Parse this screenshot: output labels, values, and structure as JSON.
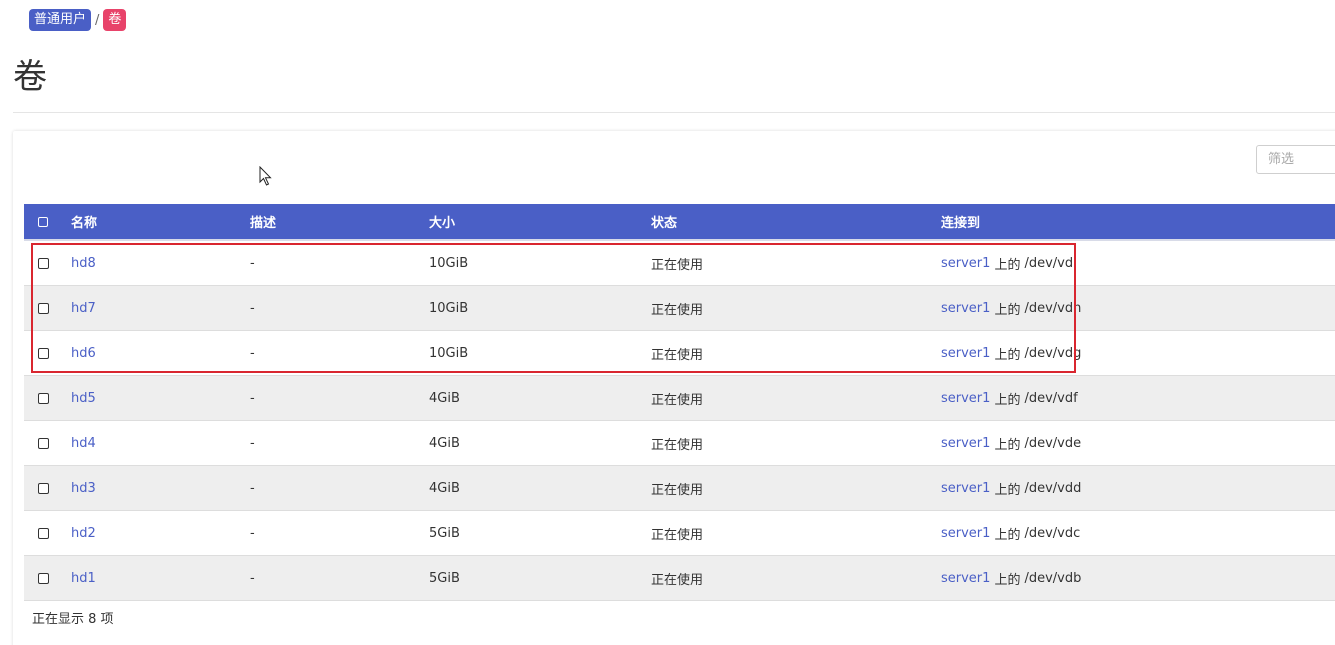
{
  "breadcrumb": {
    "user": "普通用户",
    "separator": "/",
    "current": "卷"
  },
  "page_title": "卷",
  "filter": {
    "placeholder": "筛选",
    "value": ""
  },
  "table": {
    "headers": {
      "name": "名称",
      "description": "描述",
      "size": "大小",
      "status": "状态",
      "attached_to": "连接到"
    },
    "rows": [
      {
        "name": "hd8",
        "description": "-",
        "size": "10GiB",
        "status": "正在使用",
        "server": "server1",
        "on": "上的",
        "device": "/dev/vdi"
      },
      {
        "name": "hd7",
        "description": "-",
        "size": "10GiB",
        "status": "正在使用",
        "server": "server1",
        "on": "上的",
        "device": "/dev/vdh"
      },
      {
        "name": "hd6",
        "description": "-",
        "size": "10GiB",
        "status": "正在使用",
        "server": "server1",
        "on": "上的",
        "device": "/dev/vdg"
      },
      {
        "name": "hd5",
        "description": "-",
        "size": "4GiB",
        "status": "正在使用",
        "server": "server1",
        "on": "上的",
        "device": "/dev/vdf"
      },
      {
        "name": "hd4",
        "description": "-",
        "size": "4GiB",
        "status": "正在使用",
        "server": "server1",
        "on": "上的",
        "device": "/dev/vde"
      },
      {
        "name": "hd3",
        "description": "-",
        "size": "4GiB",
        "status": "正在使用",
        "server": "server1",
        "on": "上的",
        "device": "/dev/vdd"
      },
      {
        "name": "hd2",
        "description": "-",
        "size": "5GiB",
        "status": "正在使用",
        "server": "server1",
        "on": "上的",
        "device": "/dev/vdc"
      },
      {
        "name": "hd1",
        "description": "-",
        "size": "5GiB",
        "status": "正在使用",
        "server": "server1",
        "on": "上的",
        "device": "/dev/vdb"
      }
    ]
  },
  "footer": {
    "count_text": "正在显示 8 项"
  },
  "colors": {
    "primary": "#4a5fc6",
    "volume_badge": "#e8436a",
    "highlight_border": "#d9262f"
  },
  "icons": {
    "cursor": "mouse-pointer-icon"
  }
}
